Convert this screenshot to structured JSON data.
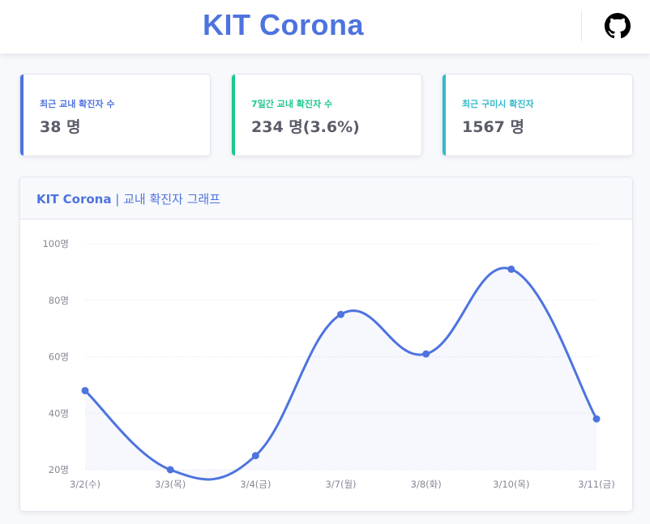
{
  "header": {
    "brand": "KIT Corona",
    "github_icon": "github-icon"
  },
  "cards": [
    {
      "label": "최근 교내 확진자 수",
      "value": "38 명",
      "accent": "#4e73df"
    },
    {
      "label": "7일간 교내 확진자 수",
      "value": "234 명(3.6%)",
      "accent": "#1cc88a"
    },
    {
      "label": "최근 구미시 확진자",
      "value": "1567 명",
      "accent": "#36b9cc"
    }
  ],
  "chart_card": {
    "title_bold": "KIT Corona",
    "title_rest": " | 교내 확진자 그래프"
  },
  "chart_data": {
    "type": "line",
    "categories": [
      "3/2(수)",
      "3/3(목)",
      "3/4(금)",
      "3/7(월)",
      "3/8(화)",
      "3/10(목)",
      "3/11(금)"
    ],
    "values": [
      48,
      20,
      25,
      75,
      61,
      91,
      38
    ],
    "ylim": [
      20,
      100
    ],
    "yticks": [
      "20명",
      "40명",
      "60명",
      "80명",
      "100명"
    ],
    "ytick_values": [
      20,
      40,
      60,
      80,
      100
    ],
    "line_color": "#4e73df",
    "fill_color": "#4e73df",
    "grid": true
  }
}
